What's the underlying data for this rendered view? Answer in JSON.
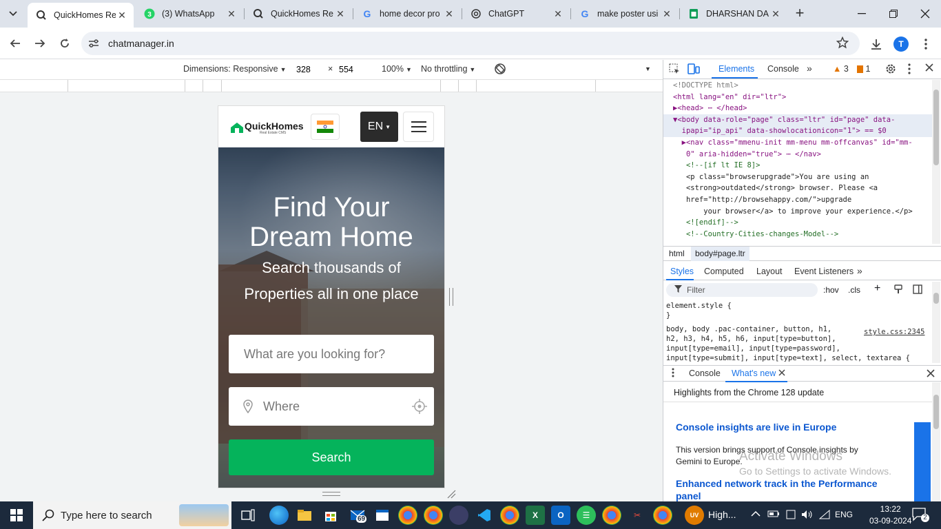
{
  "browser": {
    "tabs": [
      {
        "title": "QuickHomes Re",
        "icon": "quickhomes-favicon",
        "active": true
      },
      {
        "title": "(3) WhatsApp",
        "icon": "whatsapp-favicon",
        "badge": "3"
      },
      {
        "title": "QuickHomes Re",
        "icon": "quickhomes-favicon"
      },
      {
        "title": "home decor pro",
        "icon": "google-favicon"
      },
      {
        "title": "ChatGPT",
        "icon": "chatgpt-favicon"
      },
      {
        "title": "make poster usi",
        "icon": "google-favicon"
      },
      {
        "title": "DHARSHAN DA",
        "icon": "sheets-favicon"
      }
    ],
    "url": "chatmanager.in",
    "profile_initial": "T"
  },
  "device_toolbar": {
    "dimensions_label": "Dimensions: Responsive",
    "width": "328",
    "times": "×",
    "height": "554",
    "zoom": "100%",
    "throttling": "No throttling"
  },
  "site": {
    "logo_text": "QuickHomes",
    "logo_sub": "Real Estate CMS",
    "language": "EN",
    "hero_title_line1": "Find Your",
    "hero_title_line2": "Dream Home",
    "hero_sub_line1": "Search thousands of",
    "hero_sub_line2": "Properties all in one place",
    "search_placeholder": "What are you looking for?",
    "where_placeholder": "Where",
    "search_button": "Search",
    "accent": "#05b35b"
  },
  "devtools": {
    "tabs": [
      "Elements",
      "Console"
    ],
    "warnings": "3",
    "errors": "1",
    "dom_lines": [
      "<!DOCTYPE html>",
      "<html lang=\"en\" dir=\"ltr\">",
      "▶<head> ⋯ </head>",
      "▼<body data-role=\"page\" class=\"ltr\" id=\"page\" data-",
      "  ipapi=\"ip_api\" data-showlocationicon=\"1\"> == $0",
      "  ▶<nav class=\"mmenu-init mm-menu mm-offcanvas\" id=\"mm-",
      "   0\" aria-hidden=\"true\"> ⋯ </nav>",
      "   <!--[if lt IE 8]>",
      "   <p class=\"browserupgrade\">You are using an",
      "   <strong>outdated</strong> browser. Please <a",
      "   href=\"http://browsehappy.com/\">upgrade",
      "       your browser</a> to improve your experience.</p>",
      "   <![endif]-->",
      "   <!--Country-Cities-changes-Model-->"
    ],
    "breadcrumbs": [
      "html",
      "body#page.ltr"
    ],
    "styles_tabs": [
      "Styles",
      "Computed",
      "Layout",
      "Event Listeners"
    ],
    "filter_placeholder": "Filter",
    "hov": ":hov",
    "cls": ".cls",
    "css_lines": [
      "element.style {",
      "}",
      "body, body .pac-container, button, h1,",
      "h2, h3, h4, h5, h6, input[type=button],",
      "input[type=email], input[type=password],",
      "input[type=submit], input[type=text], select, textarea {"
    ],
    "css_source": "style.css:2345",
    "drawer_tabs": [
      "Console",
      "What's new"
    ],
    "whats_new_head": "Highlights from the Chrome 128 update",
    "wn_title1": "Console insights are live in Europe",
    "wn_body1": "This version brings support of Console insights by Gemini to Europe.",
    "wn_title2": "Enhanced network track in the Performance panel"
  },
  "watermark": {
    "line1": "Activate Windows",
    "line2": "Go to Settings to activate Windows."
  },
  "taskbar": {
    "search_placeholder": "Type here to search",
    "mail_badge": "69",
    "news_text": "High...",
    "language": "ENG",
    "time": "13:22",
    "date": "03-09-2024",
    "notification_count": "2"
  }
}
